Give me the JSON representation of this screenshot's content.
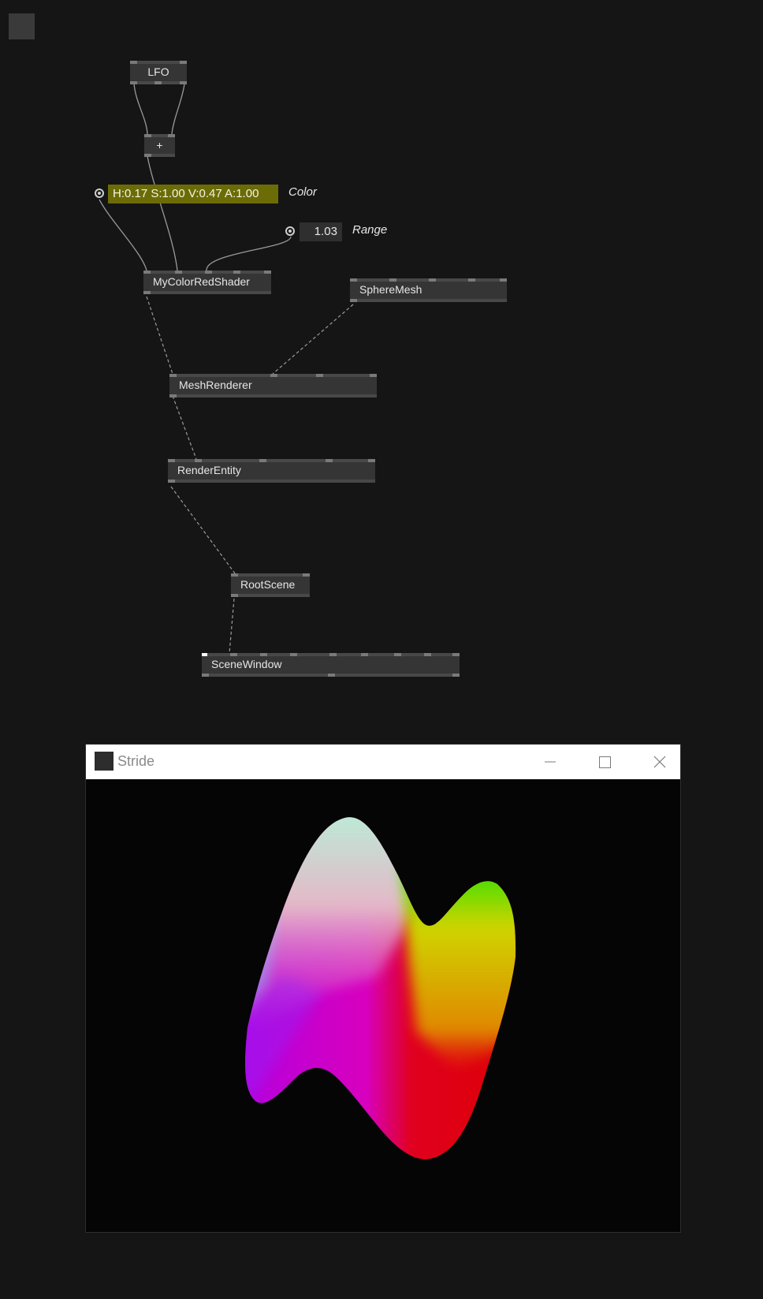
{
  "patch": {
    "nodes": {
      "lfo": "LFO",
      "add": "+",
      "shader": "MyColorRedShader",
      "sphere_mesh": "SphereMesh",
      "mesh_renderer": "MeshRenderer",
      "render_entity": "RenderEntity",
      "root_scene": "RootScene",
      "scene_window": "SceneWindow"
    },
    "color_input": {
      "value": "H:0.17 S:1.00 V:0.47 A:1.00",
      "label": "Color",
      "color": "#6c6c06"
    },
    "range_input": {
      "value": "1.03",
      "label": "Range"
    }
  },
  "render_window": {
    "title": "Stride",
    "buttons": {
      "minimize": "minimize-icon",
      "maximize": "maximize-icon",
      "close": "close-icon"
    }
  },
  "colors": {
    "background": "#151515",
    "node": "#353535",
    "pin": "#7a7a7a"
  }
}
